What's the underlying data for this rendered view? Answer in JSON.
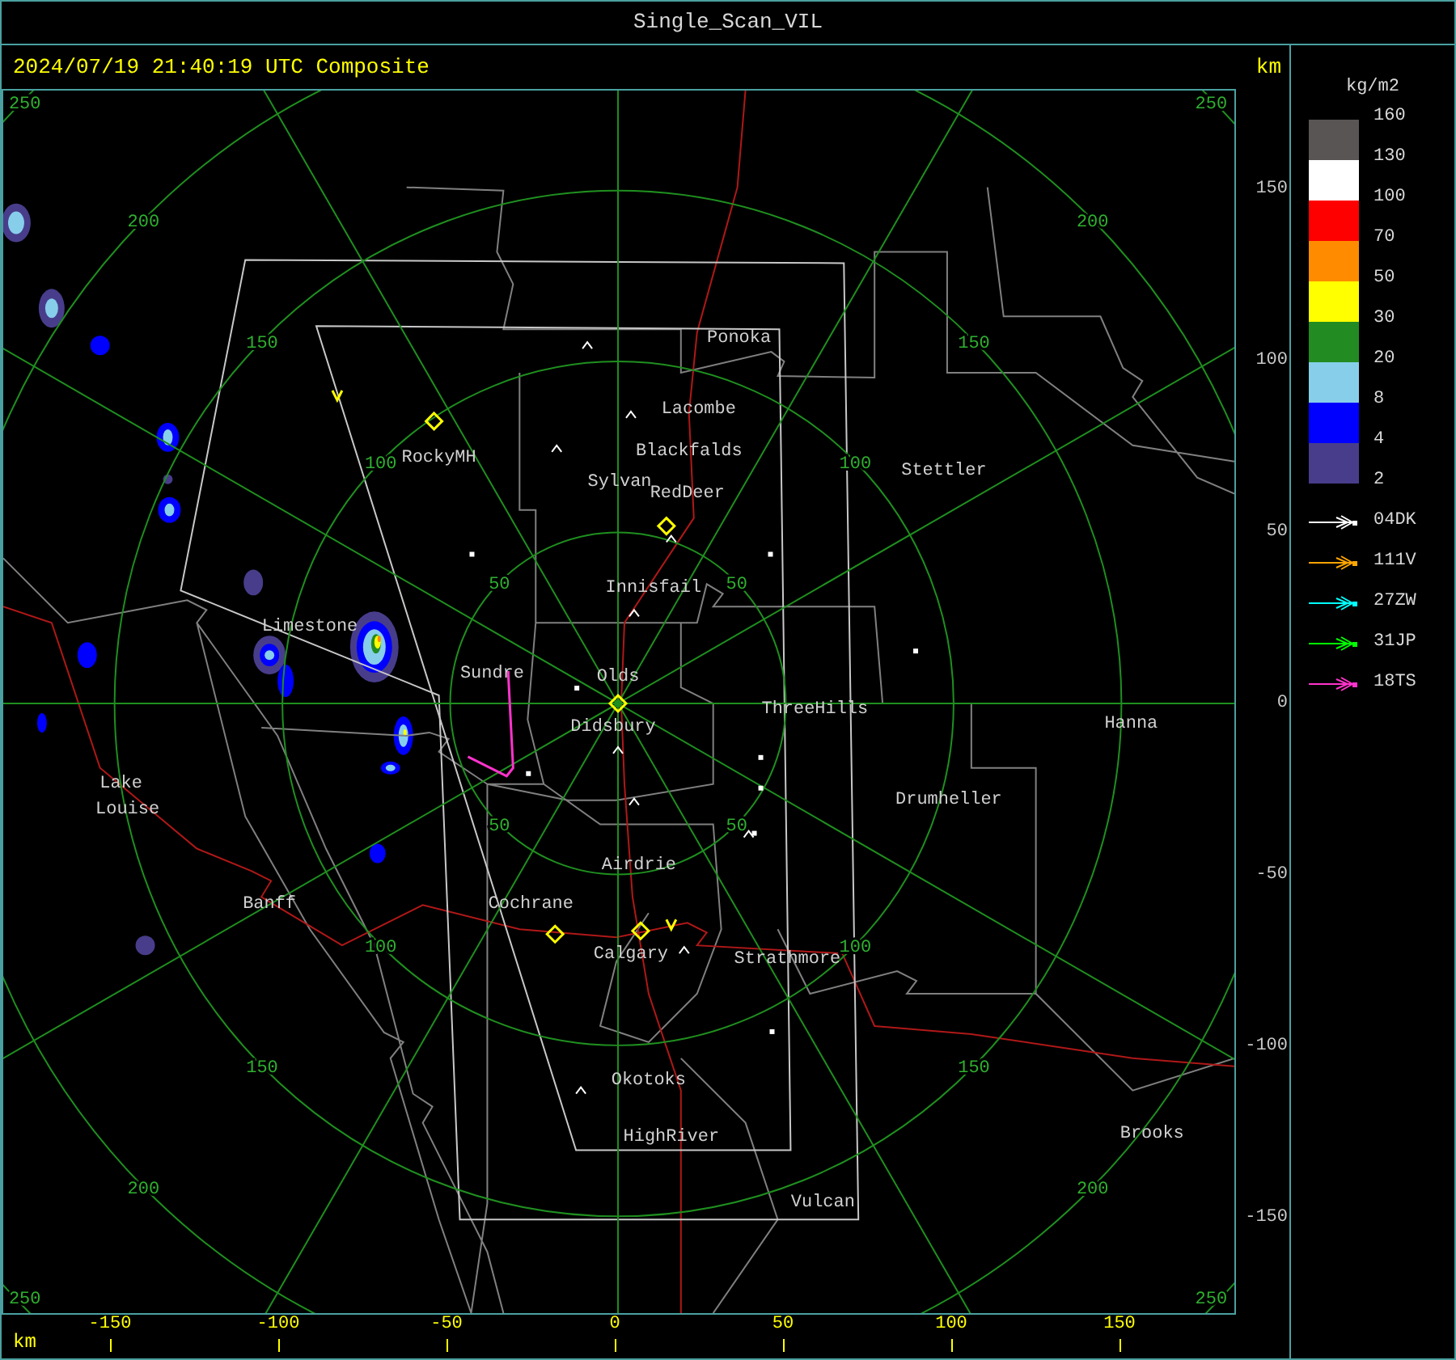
{
  "title": "Single_Scan_VIL",
  "header": {
    "timestamp": "2024/07/19 21:40:19 UTC Composite",
    "unit": "km"
  },
  "map": {
    "range_rings": [
      {
        "labels": [
          "50",
          "50",
          "50",
          "50"
        ]
      },
      {
        "labels": [
          "100",
          "100",
          "100",
          "100"
        ]
      },
      {
        "labels": [
          "150",
          "150",
          "150",
          "150"
        ]
      },
      {
        "labels": [
          "200",
          "200",
          "200",
          "200"
        ]
      },
      {
        "labels": [
          "250",
          "250",
          "250",
          "250"
        ]
      }
    ],
    "cities": [
      "Ponoka",
      "Lacombe",
      "Blackfalds",
      "Sylvan",
      "RedDeer",
      "RockyMH",
      "Stettler",
      "Innisfail",
      "Limestone",
      "Sundre",
      "Olds",
      "Didsbury",
      "ThreeHills",
      "Hanna",
      "Lake",
      "Louise",
      "Drumheller",
      "Airdrie",
      "Banff",
      "Cochrane",
      "Calgary",
      "Strathmore",
      "Okotoks",
      "HighRiver",
      "Brooks",
      "Vulcan"
    ]
  },
  "y_axis": {
    "ticks": [
      "150",
      "100",
      "50",
      "0",
      "-50",
      "-100",
      "-150"
    ]
  },
  "x_axis": {
    "unit": "km",
    "ticks": [
      "-150",
      "-100",
      "-50",
      "0",
      "50",
      "100",
      "150"
    ]
  },
  "legend": {
    "unit": "kg/m2",
    "bands": [
      {
        "color": "#5a5555"
      },
      {
        "color": "#ffffff"
      },
      {
        "color": "#ff0000"
      },
      {
        "color": "#ff8c00"
      },
      {
        "color": "#ffff00"
      },
      {
        "color": "#228b22"
      },
      {
        "color": "#87ceeb"
      },
      {
        "color": "#0000ff"
      },
      {
        "color": "#483d8b"
      }
    ],
    "labels": [
      "160",
      "130",
      "100",
      "70",
      "50",
      "30",
      "20",
      "8",
      "4",
      "2"
    ]
  },
  "tracks": [
    {
      "label": "04DK",
      "color": "#ffffff"
    },
    {
      "label": "111V",
      "color": "#ffa500"
    },
    {
      "label": "27ZW",
      "color": "#00ffff"
    },
    {
      "label": "31JP",
      "color": "#00ff00"
    },
    {
      "label": "18TS",
      "color": "#ff33cc"
    }
  ]
}
